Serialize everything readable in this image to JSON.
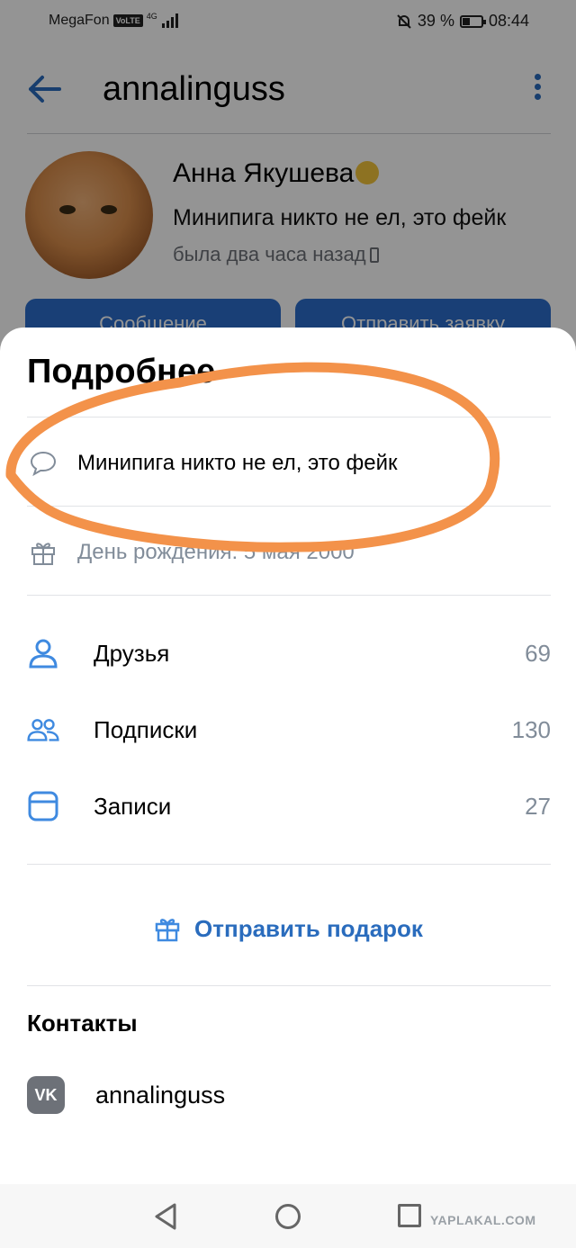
{
  "statusbar": {
    "carrier": "MegaFon",
    "volte": "VoLTE",
    "network": "4G",
    "battery_text": "39 %",
    "battery_level": 0.39,
    "time": "08:44"
  },
  "profile": {
    "username": "annalinguss",
    "name": "Анна Якушева",
    "status": "Минипига никто не ел, это фейк",
    "last_seen": "была два часа назад",
    "message_button": "Сообщение",
    "friend_request_button": "Отправить заявку"
  },
  "details": {
    "title": "Подробнее",
    "status_line": "Минипига никто не ел, это фейк",
    "birthday": "День рождения: 5 мая 2000",
    "stats": [
      {
        "label": "Друзья",
        "count": "69"
      },
      {
        "label": "Подписки",
        "count": "130"
      },
      {
        "label": "Записи",
        "count": "27"
      }
    ],
    "gift_link": "Отправить подарок",
    "contacts_title": "Контакты",
    "vk_username": "annalinguss"
  },
  "watermark": "YAPLAKAL.COM",
  "colors": {
    "accent": "#2a6cbd",
    "scribble": "#f3924a",
    "icon_blue": "#3f8ae0"
  }
}
